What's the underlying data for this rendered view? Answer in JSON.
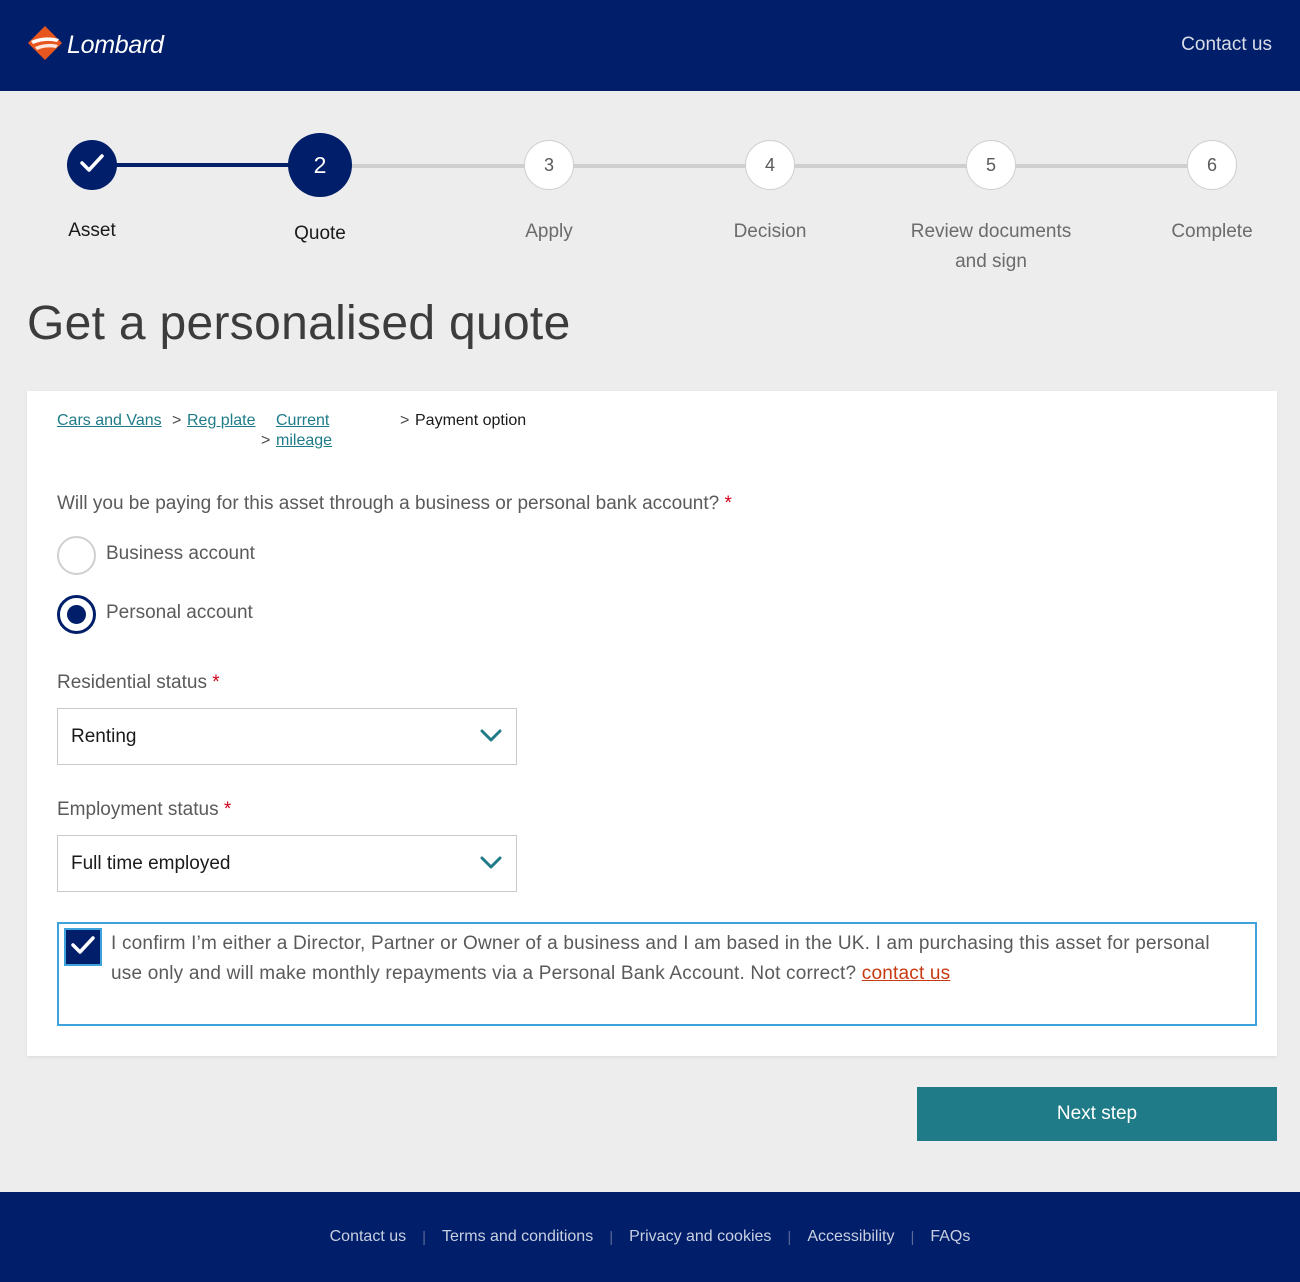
{
  "header": {
    "brand": "Lombard",
    "contact_label": "Contact us",
    "background_color": "#001e69"
  },
  "stepper": {
    "steps": [
      {
        "number": "",
        "label": "Asset",
        "state": "done",
        "icon": "check-icon"
      },
      {
        "number": "2",
        "label": "Quote",
        "state": "current"
      },
      {
        "number": "3",
        "label": "Apply",
        "state": "todo"
      },
      {
        "number": "4",
        "label": "Decision",
        "state": "todo"
      },
      {
        "number": "5",
        "label_line1": "Review documents",
        "label_line2": "and sign",
        "state": "todo"
      },
      {
        "number": "6",
        "label": "Complete",
        "state": "todo"
      }
    ]
  },
  "page_title": "Get a personalised quote",
  "breadcrumb": {
    "items": [
      {
        "label": "Cars and Vans",
        "link": true
      },
      {
        "label": "Reg plate",
        "link": true
      },
      {
        "label_line1": "Current",
        "label_line2": "mileage",
        "link": true
      },
      {
        "label": "Payment option",
        "link": false
      }
    ],
    "separator": ">"
  },
  "payment": {
    "question": "Will you be paying for this asset through a business or personal bank account?",
    "required_mark": "*",
    "options": [
      {
        "label": "Business account",
        "selected": false
      },
      {
        "label": "Personal account",
        "selected": true
      }
    ]
  },
  "residential": {
    "label": "Residential status",
    "required_mark": "*",
    "value": "Renting"
  },
  "employment": {
    "label": "Employment status",
    "required_mark": "*",
    "value": "Full time employed"
  },
  "confirm": {
    "checked": true,
    "text": "I confirm I’m either a Director, Partner or Owner of a business and I am based in the UK. I am purchasing this asset for personal use only and will make monthly repayments via a Personal Bank Account. Not correct?",
    "link_label": "contact us"
  },
  "next_button": "Next step",
  "footer": {
    "links": [
      "Contact us",
      "Terms and conditions",
      "Privacy and cookies",
      "Accessibility",
      "FAQs"
    ],
    "separator": "|"
  },
  "colors": {
    "brand_navy": "#001e69",
    "teal": "#1e7b87",
    "link_red": "#c8390f",
    "focus_blue": "#3ea3dc",
    "logo_orange": "#e8561f"
  }
}
